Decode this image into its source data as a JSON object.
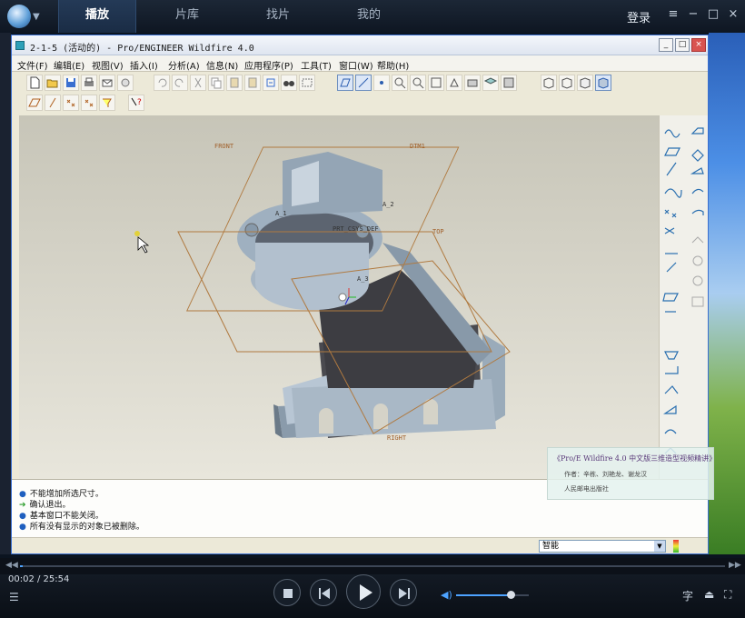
{
  "player": {
    "tabs": [
      {
        "label": "播放",
        "active": true
      },
      {
        "label": "片库",
        "active": false
      },
      {
        "label": "找片",
        "active": false
      },
      {
        "label": "我的",
        "active": false
      }
    ],
    "login_label": "登录",
    "window_controls": [
      "≡",
      "−",
      "□",
      "×"
    ],
    "current_time": "00:02",
    "total_time": "25:54",
    "time_display": "00:02 / 25:54",
    "progress_fraction": 0.0013,
    "volume_fraction": 0.75,
    "subtitle_label": "字",
    "accent_color": "#4da3ff"
  },
  "app": {
    "title": "2-1-5 (活动的) - Pro/ENGINEER Wildfire 4.0",
    "menu": [
      "文件(F)",
      "编辑(E)",
      "视图(V)",
      "插入(I)",
      "分析(A)",
      "信息(N)",
      "应用程序(P)",
      "工具(T)",
      "窗口(W)",
      "帮助(H)"
    ],
    "datum_labels": {
      "front": "FRONT",
      "dtm1": "DTM1",
      "top": "TOP",
      "right": "RIGHT",
      "csys": "PRT_CSYS_DEF",
      "a2": "A_2",
      "a1": "A_1",
      "a3": "A_3"
    },
    "messages": [
      {
        "type": "bullet",
        "text": "不能增加所选尺寸。"
      },
      {
        "type": "arrow",
        "text": "确认退出。"
      },
      {
        "type": "bullet",
        "text": "基本窗口不能关闭。"
      },
      {
        "type": "bullet",
        "text": "所有没有显示的对象已被删除。"
      }
    ],
    "filter_value": "智能"
  },
  "watermark": {
    "line1": "《Pro/E Wildfire 4.0 中文版三维造型视频精讲》",
    "line2": "作者：辛栋、刘艳龙、谢龙汉",
    "line3": "人民邮电出版社"
  }
}
